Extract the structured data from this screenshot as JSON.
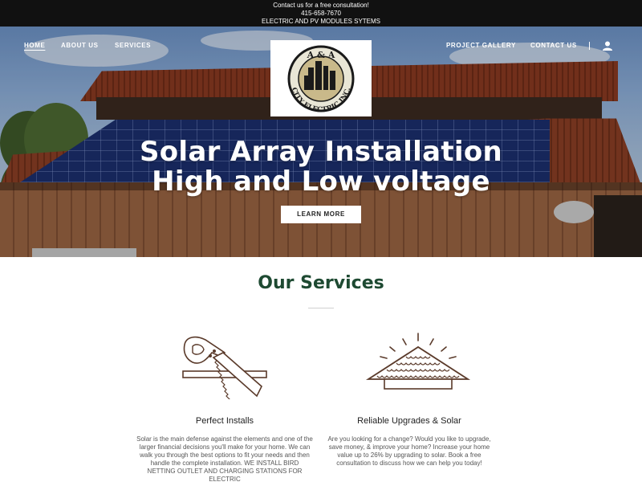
{
  "topbar": {
    "line1": "Contact us for a free consultation!",
    "line2": "415-658-7670",
    "line3": "ELECTRIC AND PV MODULES SYTEMS"
  },
  "nav": {
    "home": "HOME",
    "about": "ABOUT US",
    "services": "SERVICES",
    "gallery": "PROJECT GALLERY",
    "contact": "CONTACT US",
    "account_icon": "user-icon"
  },
  "logo": {
    "top_text": "A & A",
    "ring_text": "CITY ELECTRIC INC."
  },
  "hero": {
    "title_line1": "Solar Array Installation",
    "title_line2": "High and Low voltage",
    "cta_label": "LEARN MORE"
  },
  "services": {
    "heading": "Our Services",
    "items": [
      {
        "icon": "saw-icon",
        "title": "Perfect Installs",
        "description": "Solar is the main defense against the elements and one of the larger financial decisions you'll make for your home. We can walk you through the best options to fit your needs and then handle the complete installation. WE INSTALL BIRD NETTING OUTLET AND CHARGING STATIONS FOR ELECTRIC"
      },
      {
        "icon": "roof-icon",
        "title": "Reliable Upgrades & Solar",
        "description": "Are you looking for a change? Would you like to upgrade, save money, & improve your home? Increase your home value up to 26% by upgrading to solar. Book a free consultation to discuss how we can help you today!"
      }
    ]
  },
  "colors": {
    "topbar_bg": "#111111",
    "heading_green": "#1e4a32",
    "icon_brown": "#5a3a2a"
  }
}
